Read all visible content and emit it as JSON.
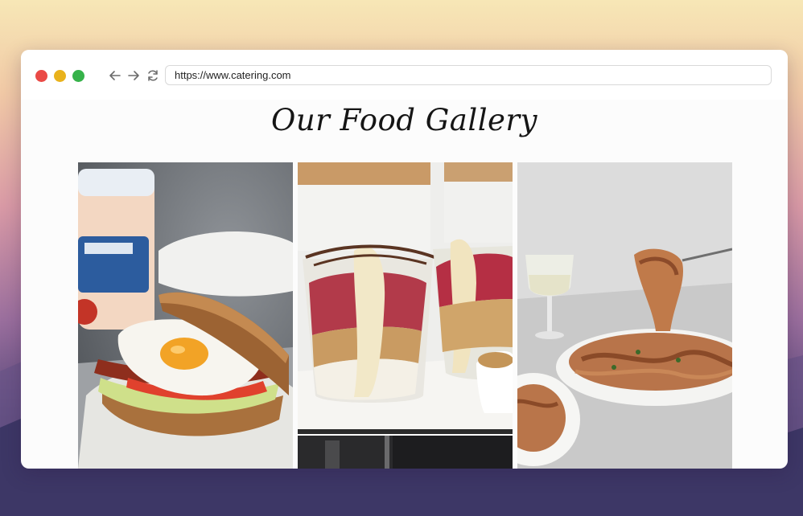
{
  "browser": {
    "url": "https://www.catering.com",
    "window_controls": [
      "close",
      "minimize",
      "maximize"
    ],
    "nav_icons": [
      "back-arrow-icon",
      "forward-arrow-icon",
      "refresh-icon"
    ]
  },
  "page": {
    "heading": "Our Food Gallery"
  },
  "gallery": {
    "items": [
      {
        "name": "egg-bacon-sandwich",
        "alt": "Fried egg, bacon and lettuce sandwich"
      },
      {
        "name": "yogurt-parfait-jars",
        "alt": "Berry banana granola parfaits in glass jars"
      },
      {
        "name": "tagliatelle-pasta",
        "alt": "Tagliatelle pasta with fork twirl"
      },
      {
        "name": "dark-photo",
        "alt": "Partially visible dark photo"
      }
    ]
  },
  "colors": {
    "close": "#ea4a46",
    "minimize": "#e9b21c",
    "maximize": "#36b24a"
  }
}
